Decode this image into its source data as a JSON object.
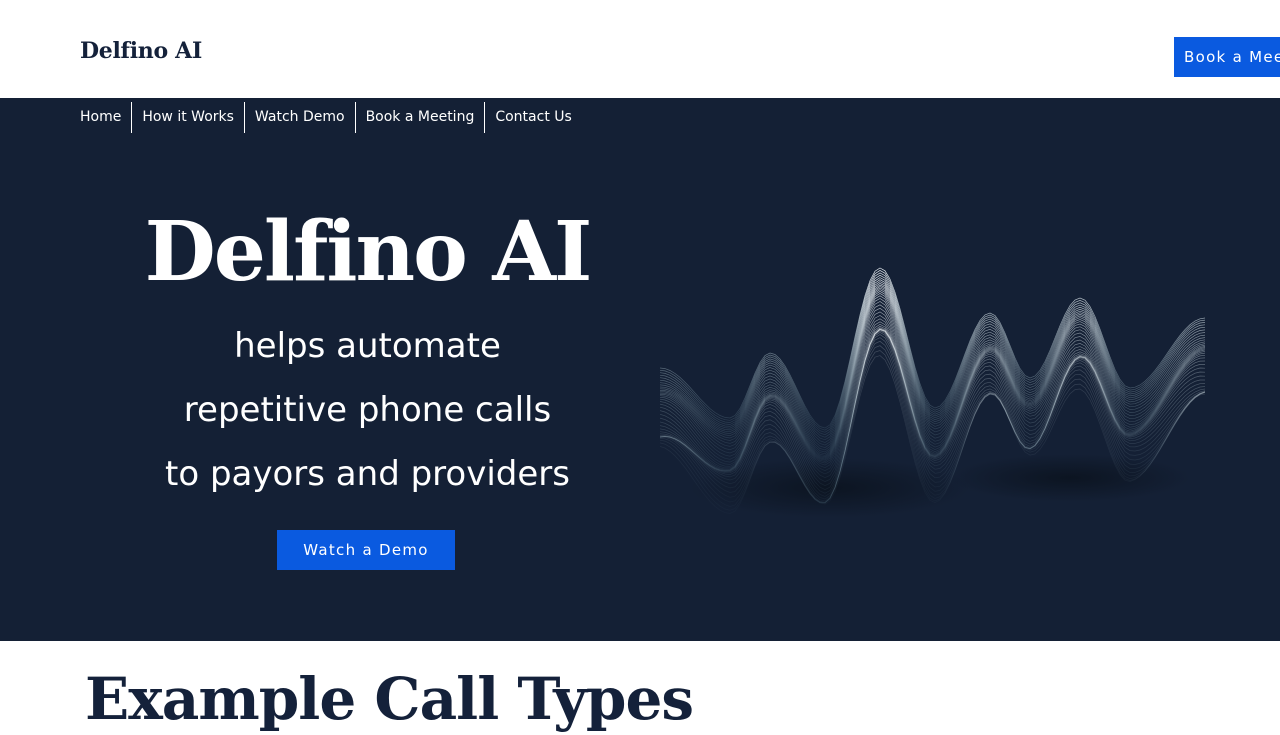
{
  "header": {
    "logo": "Delfino AI",
    "cta_label": "Book a Meeting"
  },
  "nav": {
    "items": [
      "Home",
      "How it Works",
      "Watch Demo",
      "Book a Meeting",
      "Contact Us"
    ]
  },
  "hero": {
    "title": "Delfino AI",
    "subtitle_lines": [
      "helps automate",
      "repetitive phone calls",
      "to payors and providers"
    ],
    "cta_label": "Watch a Demo",
    "graphic": "sound-wave-illustration"
  },
  "section": {
    "heading": "Example Call Types"
  },
  "colors": {
    "hero_background": "#142035",
    "accent": "#0a5ae0",
    "heading_text": "#14213a"
  }
}
